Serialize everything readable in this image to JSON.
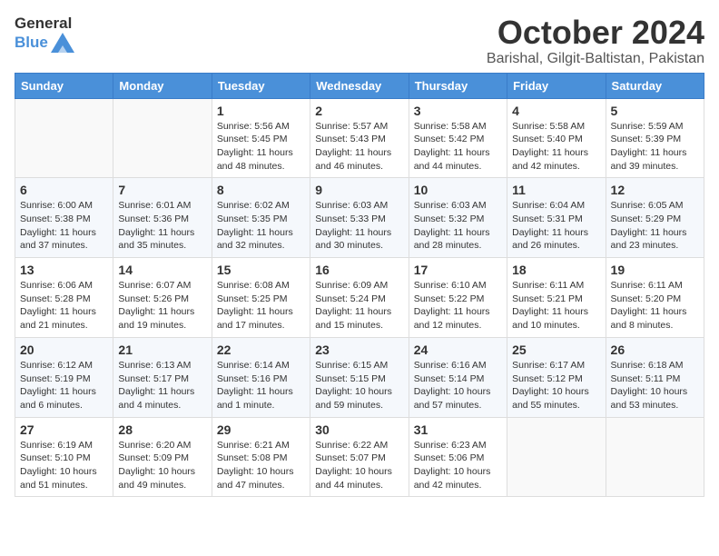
{
  "logo": {
    "text_general": "General",
    "text_blue": "Blue"
  },
  "title": "October 2024",
  "subtitle": "Barishal, Gilgit-Baltistan, Pakistan",
  "days_of_week": [
    "Sunday",
    "Monday",
    "Tuesday",
    "Wednesday",
    "Thursday",
    "Friday",
    "Saturday"
  ],
  "weeks": [
    [
      {
        "day": null
      },
      {
        "day": null
      },
      {
        "day": 1,
        "sunrise": "Sunrise: 5:56 AM",
        "sunset": "Sunset: 5:45 PM",
        "daylight": "Daylight: 11 hours and 48 minutes."
      },
      {
        "day": 2,
        "sunrise": "Sunrise: 5:57 AM",
        "sunset": "Sunset: 5:43 PM",
        "daylight": "Daylight: 11 hours and 46 minutes."
      },
      {
        "day": 3,
        "sunrise": "Sunrise: 5:58 AM",
        "sunset": "Sunset: 5:42 PM",
        "daylight": "Daylight: 11 hours and 44 minutes."
      },
      {
        "day": 4,
        "sunrise": "Sunrise: 5:58 AM",
        "sunset": "Sunset: 5:40 PM",
        "daylight": "Daylight: 11 hours and 42 minutes."
      },
      {
        "day": 5,
        "sunrise": "Sunrise: 5:59 AM",
        "sunset": "Sunset: 5:39 PM",
        "daylight": "Daylight: 11 hours and 39 minutes."
      }
    ],
    [
      {
        "day": 6,
        "sunrise": "Sunrise: 6:00 AM",
        "sunset": "Sunset: 5:38 PM",
        "daylight": "Daylight: 11 hours and 37 minutes."
      },
      {
        "day": 7,
        "sunrise": "Sunrise: 6:01 AM",
        "sunset": "Sunset: 5:36 PM",
        "daylight": "Daylight: 11 hours and 35 minutes."
      },
      {
        "day": 8,
        "sunrise": "Sunrise: 6:02 AM",
        "sunset": "Sunset: 5:35 PM",
        "daylight": "Daylight: 11 hours and 32 minutes."
      },
      {
        "day": 9,
        "sunrise": "Sunrise: 6:03 AM",
        "sunset": "Sunset: 5:33 PM",
        "daylight": "Daylight: 11 hours and 30 minutes."
      },
      {
        "day": 10,
        "sunrise": "Sunrise: 6:03 AM",
        "sunset": "Sunset: 5:32 PM",
        "daylight": "Daylight: 11 hours and 28 minutes."
      },
      {
        "day": 11,
        "sunrise": "Sunrise: 6:04 AM",
        "sunset": "Sunset: 5:31 PM",
        "daylight": "Daylight: 11 hours and 26 minutes."
      },
      {
        "day": 12,
        "sunrise": "Sunrise: 6:05 AM",
        "sunset": "Sunset: 5:29 PM",
        "daylight": "Daylight: 11 hours and 23 minutes."
      }
    ],
    [
      {
        "day": 13,
        "sunrise": "Sunrise: 6:06 AM",
        "sunset": "Sunset: 5:28 PM",
        "daylight": "Daylight: 11 hours and 21 minutes."
      },
      {
        "day": 14,
        "sunrise": "Sunrise: 6:07 AM",
        "sunset": "Sunset: 5:26 PM",
        "daylight": "Daylight: 11 hours and 19 minutes."
      },
      {
        "day": 15,
        "sunrise": "Sunrise: 6:08 AM",
        "sunset": "Sunset: 5:25 PM",
        "daylight": "Daylight: 11 hours and 17 minutes."
      },
      {
        "day": 16,
        "sunrise": "Sunrise: 6:09 AM",
        "sunset": "Sunset: 5:24 PM",
        "daylight": "Daylight: 11 hours and 15 minutes."
      },
      {
        "day": 17,
        "sunrise": "Sunrise: 6:10 AM",
        "sunset": "Sunset: 5:22 PM",
        "daylight": "Daylight: 11 hours and 12 minutes."
      },
      {
        "day": 18,
        "sunrise": "Sunrise: 6:11 AM",
        "sunset": "Sunset: 5:21 PM",
        "daylight": "Daylight: 11 hours and 10 minutes."
      },
      {
        "day": 19,
        "sunrise": "Sunrise: 6:11 AM",
        "sunset": "Sunset: 5:20 PM",
        "daylight": "Daylight: 11 hours and 8 minutes."
      }
    ],
    [
      {
        "day": 20,
        "sunrise": "Sunrise: 6:12 AM",
        "sunset": "Sunset: 5:19 PM",
        "daylight": "Daylight: 11 hours and 6 minutes."
      },
      {
        "day": 21,
        "sunrise": "Sunrise: 6:13 AM",
        "sunset": "Sunset: 5:17 PM",
        "daylight": "Daylight: 11 hours and 4 minutes."
      },
      {
        "day": 22,
        "sunrise": "Sunrise: 6:14 AM",
        "sunset": "Sunset: 5:16 PM",
        "daylight": "Daylight: 11 hours and 1 minute."
      },
      {
        "day": 23,
        "sunrise": "Sunrise: 6:15 AM",
        "sunset": "Sunset: 5:15 PM",
        "daylight": "Daylight: 10 hours and 59 minutes."
      },
      {
        "day": 24,
        "sunrise": "Sunrise: 6:16 AM",
        "sunset": "Sunset: 5:14 PM",
        "daylight": "Daylight: 10 hours and 57 minutes."
      },
      {
        "day": 25,
        "sunrise": "Sunrise: 6:17 AM",
        "sunset": "Sunset: 5:12 PM",
        "daylight": "Daylight: 10 hours and 55 minutes."
      },
      {
        "day": 26,
        "sunrise": "Sunrise: 6:18 AM",
        "sunset": "Sunset: 5:11 PM",
        "daylight": "Daylight: 10 hours and 53 minutes."
      }
    ],
    [
      {
        "day": 27,
        "sunrise": "Sunrise: 6:19 AM",
        "sunset": "Sunset: 5:10 PM",
        "daylight": "Daylight: 10 hours and 51 minutes."
      },
      {
        "day": 28,
        "sunrise": "Sunrise: 6:20 AM",
        "sunset": "Sunset: 5:09 PM",
        "daylight": "Daylight: 10 hours and 49 minutes."
      },
      {
        "day": 29,
        "sunrise": "Sunrise: 6:21 AM",
        "sunset": "Sunset: 5:08 PM",
        "daylight": "Daylight: 10 hours and 47 minutes."
      },
      {
        "day": 30,
        "sunrise": "Sunrise: 6:22 AM",
        "sunset": "Sunset: 5:07 PM",
        "daylight": "Daylight: 10 hours and 44 minutes."
      },
      {
        "day": 31,
        "sunrise": "Sunrise: 6:23 AM",
        "sunset": "Sunset: 5:06 PM",
        "daylight": "Daylight: 10 hours and 42 minutes."
      },
      {
        "day": null
      },
      {
        "day": null
      }
    ]
  ]
}
